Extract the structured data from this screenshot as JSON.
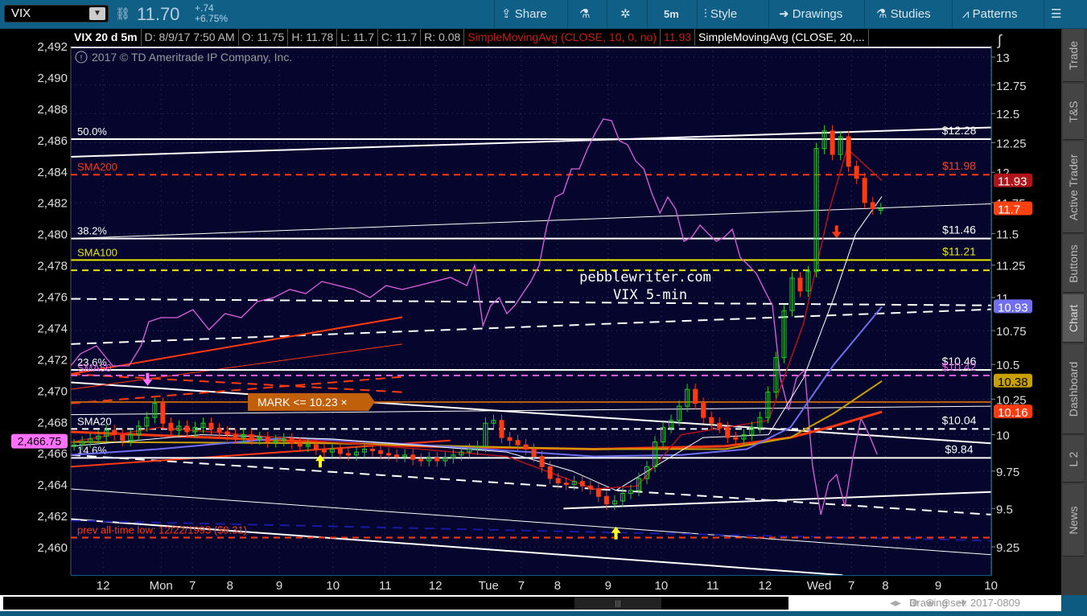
{
  "toolbar": {
    "symbol": "VIX",
    "last": "11.70",
    "change": "+.74",
    "change_pct": "+6.75%",
    "share": "Share",
    "timeframe": "5m",
    "style": "Style",
    "drawings": "Drawings",
    "studies": "Studies",
    "patterns": "Patterns"
  },
  "info": {
    "title": "VIX 20 d 5m",
    "date": "D: 8/9/17 7:50 AM",
    "open": "O: 11.75",
    "high": "H: 11.78",
    "low": "L: 11.7",
    "close": "C: 11.7",
    "range": "R: 0.08",
    "study1": "SimpleMovingAvg (CLOSE, 10, 0, no)",
    "study1_value": "11.93",
    "study2": "SimpleMovingAvg (CLOSE, 20,..."
  },
  "copyright": "2017 © TD Ameritrade IP Company, Inc.",
  "side_tabs": [
    "Trade",
    "T&S",
    "Active Trader",
    "Buttons",
    "Chart",
    "Dashboard",
    "L 2",
    "News"
  ],
  "selected_tab": "Chart",
  "bottom": {
    "drawing_set": "Drawing set: 2017-0809"
  },
  "watermark": [
    "pebblewriter.com",
    "VIX 5-min"
  ],
  "mark_alert": "MARK <= 10.23 ×",
  "colors": {
    "bg": "#05052e",
    "candle_up": "#22cc22",
    "candle_down": "#ff3a10",
    "sma10": "#b0141a",
    "sma20": "#ffffff",
    "sma50": "#6f6ff0",
    "sma100": "#c8a000",
    "sma200": "#ff3a10",
    "spx": "#e060e0",
    "mark": "#c0600a"
  },
  "chart_data": {
    "type": "candlestick",
    "right_axis": {
      "ticks": [
        13,
        12.75,
        12.5,
        12.25,
        12,
        11.75,
        11.5,
        11.25,
        11,
        10.75,
        10.5,
        10.25,
        10,
        9.75,
        9.5,
        9.25
      ],
      "scale": "log"
    },
    "left_axis": {
      "ticks": [
        "2,492",
        "2,490",
        "2,488",
        "2,486",
        "2,484",
        "2,482",
        "2,480",
        "2,478",
        "2,476",
        "2,474",
        "2,472",
        "2,470",
        "2,468",
        "2,466",
        "2,464",
        "2,462",
        "2,460"
      ],
      "range": [
        2460,
        2492
      ]
    },
    "x_ticks": [
      {
        "label": "12",
        "bar": 7.4
      },
      {
        "label": "Mon",
        "bar": 20.7
      },
      {
        "label": "7",
        "bar": 27.9
      },
      {
        "label": "8",
        "bar": 36.5
      },
      {
        "label": "9",
        "bar": 47.8
      },
      {
        "label": "10",
        "bar": 60.1
      },
      {
        "label": "11",
        "bar": 72.1
      },
      {
        "label": "12",
        "bar": 83.6
      },
      {
        "label": "Tue",
        "bar": 95.8
      },
      {
        "label": "7",
        "bar": 103.3
      },
      {
        "label": "8",
        "bar": 111.6
      },
      {
        "label": "9",
        "bar": 123.2
      },
      {
        "label": "10",
        "bar": 135.4
      },
      {
        "label": "11",
        "bar": 147.2
      },
      {
        "label": "12",
        "bar": 159.2
      },
      {
        "label": "Wed",
        "bar": 171.6
      },
      {
        "label": "7",
        "bar": 179
      },
      {
        "label": "8",
        "bar": 186.8
      },
      {
        "label": "9",
        "bar": 198.9
      },
      {
        "label": "10",
        "bar": 211
      }
    ],
    "vix": {
      "start_bar": 0.75,
      "step_bars": 1.85,
      "closes": [
        9.93,
        9.95,
        9.97,
        9.99,
        10.03,
        10.0,
        9.96,
        10.0,
        10.06,
        10.12,
        10.22,
        10.08,
        10.03,
        10.06,
        10.02,
        10.05,
        10.08,
        10.04,
        10.02,
        10.0,
        9.98,
        10.0,
        9.97,
        9.98,
        9.95,
        9.96,
        9.97,
        9.94,
        9.92,
        9.93,
        9.9,
        9.88,
        9.9,
        9.87,
        9.86,
        9.88,
        9.9,
        9.89,
        9.87,
        9.86,
        9.85,
        9.86,
        9.83,
        9.82,
        9.84,
        9.82,
        9.84,
        9.86,
        9.88,
        9.9,
        9.92,
        10.08,
        10.1,
        9.98,
        9.96,
        9.93,
        9.9,
        9.85,
        9.78,
        9.7,
        9.67,
        9.66,
        9.68,
        9.65,
        9.63,
        9.58,
        9.53,
        9.55,
        9.6,
        9.62,
        9.7,
        9.78,
        9.95,
        10.05,
        10.1,
        10.2,
        10.32,
        10.22,
        10.12,
        10.08,
        10.05,
        9.98,
        9.97,
        10.0,
        10.05,
        10.12,
        10.3,
        10.55,
        10.9,
        11.15,
        11.05,
        11.2,
        12.2,
        12.35,
        12.15,
        12.3,
        12.05,
        11.95,
        11.75,
        11.7,
        11.7
      ]
    },
    "spx": [
      [
        0,
        2471.56
      ],
      [
        2.2,
        2472.33
      ],
      [
        5.9,
        2472.84
      ],
      [
        9.6,
        2471.56
      ],
      [
        13.3,
        2471.56
      ],
      [
        16.1,
        2472.84
      ],
      [
        17.9,
        2474.38
      ],
      [
        20.7,
        2474.64
      ],
      [
        24.4,
        2474.64
      ],
      [
        28,
        2475.15
      ],
      [
        31.7,
        2473.87
      ],
      [
        35.4,
        2474.9
      ],
      [
        39.1,
        2474.64
      ],
      [
        42.8,
        2475.67
      ],
      [
        46.5,
        2475.92
      ],
      [
        50.2,
        2476.44
      ],
      [
        53.9,
        2476.18
      ],
      [
        57.6,
        2476.95
      ],
      [
        61.3,
        2476.69
      ],
      [
        64.9,
        2476.44
      ],
      [
        68.6,
        2475.92
      ],
      [
        72.3,
        2476.69
      ],
      [
        76,
        2476.44
      ],
      [
        79.7,
        2476.69
      ],
      [
        83.4,
        2476.95
      ],
      [
        87.1,
        2477.21
      ],
      [
        90.8,
        2476.69
      ],
      [
        92.6,
        2477.98
      ],
      [
        94.5,
        2474.13
      ],
      [
        96.3,
        2475.41
      ],
      [
        98.2,
        2475.92
      ],
      [
        100,
        2474.9
      ],
      [
        101.8,
        2475.41
      ],
      [
        105.5,
        2476.95
      ],
      [
        107.4,
        2477.98
      ],
      [
        109.2,
        2480.55
      ],
      [
        111.1,
        2482.34
      ],
      [
        112.9,
        2482.6
      ],
      [
        114.8,
        2484.14
      ],
      [
        116.6,
        2484.14
      ],
      [
        118.5,
        2485.43
      ],
      [
        120.3,
        2486.45
      ],
      [
        122.1,
        2487.33
      ],
      [
        124,
        2487.22
      ],
      [
        125.8,
        2485.94
      ],
      [
        127.7,
        2485.68
      ],
      [
        129.5,
        2484.66
      ],
      [
        131.4,
        2484.14
      ],
      [
        133.2,
        2482.6
      ],
      [
        135.1,
        2481.32
      ],
      [
        136.9,
        2482.34
      ],
      [
        138.7,
        2481.57
      ],
      [
        140.6,
        2479.52
      ],
      [
        142.4,
        2479.78
      ],
      [
        144.3,
        2480.55
      ],
      [
        146.1,
        2480.03
      ],
      [
        148,
        2479.52
      ],
      [
        149.8,
        2479.78
      ],
      [
        151.7,
        2480.29
      ],
      [
        153.5,
        2478.49
      ],
      [
        155.4,
        2477.98
      ],
      [
        157.2,
        2477.46
      ],
      [
        159,
        2476.44
      ],
      [
        160.9,
        2475.41
      ],
      [
        162.7,
        2470.79
      ],
      [
        164.6,
        2468.73
      ],
      [
        166.4,
        2470.79
      ],
      [
        168.3,
        2471.3
      ],
      [
        170.1,
        2465.14
      ],
      [
        172,
        2462.06
      ],
      [
        173.8,
        2464.11
      ],
      [
        175.6,
        2464.62
      ],
      [
        177.5,
        2462.57
      ],
      [
        179.3,
        2465.65
      ],
      [
        181.2,
        2468.22
      ],
      [
        183,
        2467.19
      ],
      [
        184.9,
        2465.91
      ]
    ],
    "spx_last": "2,466.75",
    "smas": [
      {
        "name": "SMA200",
        "color": "#ff3a10",
        "width": 3,
        "last": "10.16",
        "points": [
          [
            0,
            10.02
          ],
          [
            40,
            9.97
          ],
          [
            80,
            9.92
          ],
          [
            120,
            9.9
          ],
          [
            150,
            9.92
          ],
          [
            165,
            9.98
          ],
          [
            175,
            10.06
          ],
          [
            186,
            10.16
          ]
        ]
      },
      {
        "name": "SMA100",
        "color": "#c8a000",
        "width": 2,
        "last": "10.38",
        "points": [
          [
            0,
            9.95
          ],
          [
            60,
            9.94
          ],
          [
            120,
            9.9
          ],
          [
            150,
            9.9
          ],
          [
            165,
            9.98
          ],
          [
            175,
            10.15
          ],
          [
            186,
            10.38
          ]
        ]
      },
      {
        "name": "SMA50",
        "color": "#6f6ff0",
        "width": 2,
        "last": "10.93",
        "points": [
          [
            0,
            9.86
          ],
          [
            20,
            9.9
          ],
          [
            50,
            9.98
          ],
          [
            80,
            9.93
          ],
          [
            120,
            9.85
          ],
          [
            140,
            9.86
          ],
          [
            155,
            9.9
          ],
          [
            165,
            10.05
          ],
          [
            175,
            10.5
          ],
          [
            186,
            10.93
          ]
        ]
      },
      {
        "name": "SMA20",
        "color": "#ffffff",
        "width": 1,
        "last": "",
        "points": [
          [
            0,
            9.92
          ],
          [
            30,
            10.0
          ],
          [
            60,
            9.97
          ],
          [
            100,
            9.88
          ],
          [
            115,
            9.75
          ],
          [
            125,
            9.62
          ],
          [
            135,
            9.8
          ],
          [
            145,
            9.98
          ],
          [
            160,
            10.0
          ],
          [
            168,
            10.4
          ],
          [
            175,
            11.0
          ],
          [
            180,
            11.5
          ],
          [
            186,
            11.8
          ]
        ]
      },
      {
        "name": "SMA10",
        "color": "#b0141a",
        "width": 1.5,
        "last": "11.93",
        "points": [
          [
            0,
            9.95
          ],
          [
            20,
            10.05
          ],
          [
            60,
            9.95
          ],
          [
            100,
            9.85
          ],
          [
            120,
            9.63
          ],
          [
            130,
            9.65
          ],
          [
            140,
            10.0
          ],
          [
            150,
            10.05
          ],
          [
            160,
            10.1
          ],
          [
            168,
            10.8
          ],
          [
            174,
            11.7
          ],
          [
            178,
            12.2
          ],
          [
            186,
            11.93
          ]
        ]
      }
    ],
    "last_badges": [
      {
        "value": "11.93",
        "color": "#b0141a"
      },
      {
        "value": "11.7",
        "color": "#ff4010"
      },
      {
        "value": "10.93",
        "color": "#6f6ff0"
      },
      {
        "value": "10.38",
        "color": "#c8a000",
        "text": "#000"
      },
      {
        "value": "10.16",
        "color": "#ff3a10"
      }
    ],
    "levels": [
      {
        "label": "50.0%",
        "price": 12.28,
        "right": "$12.28",
        "color": "#ffffff",
        "dash": false
      },
      {
        "label": "SMA200",
        "price": 11.98,
        "right": "$11.98",
        "color": "#ff3a10",
        "dash": true
      },
      {
        "label": "38.2%",
        "price": 11.46,
        "right": "$11.46",
        "color": "#ffffff",
        "dash": false
      },
      {
        "label": "SMA100",
        "price": 11.29,
        "right": "$11.21",
        "color": "#e6e600",
        "dash": false
      },
      {
        "label": "",
        "price": 11.21,
        "right": "",
        "color": "#e6e600",
        "dash": true
      },
      {
        "label": "23.6%",
        "price": 10.46,
        "right": "$10.46",
        "color": "#ffffff",
        "dash": false
      },
      {
        "label": "SMA50",
        "price": 10.42,
        "right": "$10.42",
        "color": "#e060e0",
        "dash": true
      },
      {
        "label": "",
        "price": 10.23,
        "right": "",
        "color": "#c0600a",
        "dash": false
      },
      {
        "label": "SMA20",
        "price": 10.04,
        "right": "$10.04",
        "color": "#ffffff",
        "dash": true
      },
      {
        "label": "14.6%",
        "price": 9.84,
        "right": "$9.84",
        "color": "#ffffff",
        "dash": false
      },
      {
        "label": "prev all-time low: 12/22/1993 ($9.31)",
        "price": 9.31,
        "right": "",
        "color": "#ff3a10",
        "dash": true
      }
    ],
    "trendlines": [
      {
        "from": [
          0,
          12.13
        ],
        "to": [
          211,
          12.38
        ],
        "color": "#ffffff",
        "w": 2,
        "dash": false
      },
      {
        "from": [
          0,
          11.46
        ],
        "to": [
          211,
          11.74
        ],
        "color": "#ffffff",
        "w": 1,
        "dash": false
      },
      {
        "from": [
          0,
          10.99
        ],
        "to": [
          211,
          10.94
        ],
        "color": "#ffffff",
        "w": 2,
        "dash": true
      },
      {
        "from": [
          0,
          10.65
        ],
        "to": [
          211,
          10.91
        ],
        "color": "#ffffff",
        "w": 2,
        "dash": true
      },
      {
        "from": [
          0,
          10.37
        ],
        "to": [
          211,
          9.94
        ],
        "color": "#ffffff",
        "w": 2,
        "dash": false
      },
      {
        "from": [
          0,
          10.14
        ],
        "to": [
          211,
          10.2
        ],
        "color": "#ffffff",
        "w": 1,
        "dash": false
      },
      {
        "from": [
          0,
          9.86
        ],
        "to": [
          211,
          9.46
        ],
        "color": "#ffffff",
        "w": 2,
        "dash": true
      },
      {
        "from": [
          113,
          9.5
        ],
        "to": [
          211,
          9.61
        ],
        "color": "#ffffff",
        "w": 2,
        "dash": false
      },
      {
        "from": [
          0,
          9.63
        ],
        "to": [
          211,
          9.2
        ],
        "color": "#ffffff",
        "w": 1,
        "dash": false
      },
      {
        "from": [
          0,
          9.43
        ],
        "to": [
          177,
          9.07
        ],
        "color": "#ffffff",
        "w": 2,
        "dash": false
      },
      {
        "from": [
          0,
          9.78
        ],
        "to": [
          87,
          9.96
        ],
        "color": "#ff3a10",
        "w": 2,
        "dash": false
      },
      {
        "from": [
          0,
          10.43
        ],
        "to": [
          76,
          10.85
        ],
        "color": "#ff3a10",
        "w": 2,
        "dash": false
      },
      {
        "from": [
          0,
          10.32
        ],
        "to": [
          76,
          10.65
        ],
        "color": "#ff3a10",
        "w": 1,
        "dash": false
      },
      {
        "from": [
          0,
          10.22
        ],
        "to": [
          76,
          10.41
        ],
        "color": "#ff3a10",
        "w": 2,
        "dash": true
      },
      {
        "from": [
          0,
          10.43
        ],
        "to": [
          76,
          10.3
        ],
        "color": "#ff3a10",
        "w": 2,
        "dash": true
      },
      {
        "from": [
          0,
          9.42
        ],
        "to": [
          211,
          9.29
        ],
        "color": "#1a1aa0",
        "w": 2,
        "dash": true
      }
    ],
    "arrows": [
      {
        "bar": 17.6,
        "price": 10.38,
        "dir": "down",
        "color": "#ff70ff"
      },
      {
        "bar": 57.2,
        "price": 9.83,
        "dir": "up",
        "color": "#ffff20"
      },
      {
        "bar": 125,
        "price": 9.35,
        "dir": "up",
        "color": "#ffff20"
      },
      {
        "bar": 175.6,
        "price": 11.5,
        "dir": "down",
        "color": "#ff3a10"
      }
    ]
  }
}
